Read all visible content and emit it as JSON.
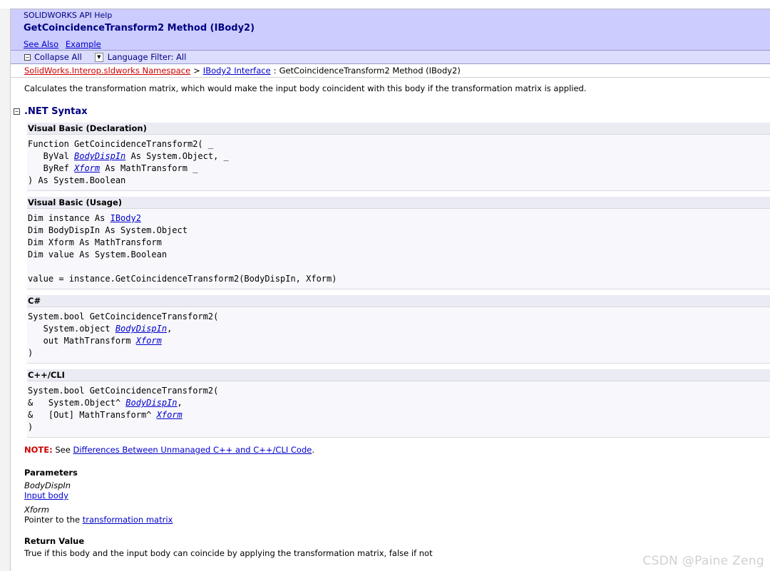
{
  "header": {
    "app_name": "SOLIDWORKS API Help",
    "title": "GetCoincidenceTransform2 Method (IBody2)",
    "links": [
      "See Also",
      "Example"
    ]
  },
  "toolbar": {
    "collapse_label": "Collapse All",
    "language_filter_label": "Language Filter: All"
  },
  "breadcrumb": {
    "namespace": "SolidWorks.Interop.sldworks Namespace",
    "sep1": ">",
    "interface": "IBody2 Interface",
    "sep2": ":",
    "current": "GetCoincidenceTransform2 Method (IBody2)"
  },
  "summary": "Calculates the transformation matrix, which would make the input body coincident with this body if the transformation matrix is applied.",
  "syntax_section": {
    "title": ".NET Syntax",
    "blocks": [
      {
        "header": "Visual Basic (Declaration)",
        "lines": [
          [
            {
              "t": "Function GetCoincidenceTransform2( _"
            }
          ],
          [
            {
              "t": "   ByVal "
            },
            {
              "t": "BodyDispIn",
              "link": true
            },
            {
              "t": " As System.Object, _"
            }
          ],
          [
            {
              "t": "   ByRef "
            },
            {
              "t": "Xform",
              "link": true
            },
            {
              "t": " As MathTransform _"
            }
          ],
          [
            {
              "t": ") As System.Boolean"
            }
          ]
        ]
      },
      {
        "header": "Visual Basic (Usage)",
        "lines": [
          [
            {
              "t": "Dim instance As "
            },
            {
              "t": "IBody2",
              "link": true,
              "plain": true
            }
          ],
          [
            {
              "t": "Dim BodyDispIn As System.Object"
            }
          ],
          [
            {
              "t": "Dim Xform As MathTransform"
            }
          ],
          [
            {
              "t": "Dim value As System.Boolean"
            }
          ],
          [
            {
              "t": " "
            }
          ],
          [
            {
              "t": "value = instance.GetCoincidenceTransform2(BodyDispIn, Xform)"
            }
          ]
        ]
      },
      {
        "header": "C#",
        "lines": [
          [
            {
              "t": "System.bool GetCoincidenceTransform2("
            }
          ],
          [
            {
              "t": "   System.object "
            },
            {
              "t": "BodyDispIn",
              "link": true
            },
            {
              "t": ","
            }
          ],
          [
            {
              "t": "   out MathTransform "
            },
            {
              "t": "Xform",
              "link": true
            }
          ],
          [
            {
              "t": ")"
            }
          ]
        ]
      },
      {
        "header": "C++/CLI",
        "lines": [
          [
            {
              "t": "System.bool GetCoincidenceTransform2("
            }
          ],
          [
            {
              "t": "&   System.Object^ "
            },
            {
              "t": "BodyDispIn",
              "link": true
            },
            {
              "t": ","
            }
          ],
          [
            {
              "t": "&   [Out] MathTransform^ "
            },
            {
              "t": "Xform",
              "link": true
            }
          ],
          [
            {
              "t": ")"
            }
          ]
        ]
      }
    ]
  },
  "note": {
    "label": "NOTE:",
    "prefix": " See ",
    "link": "Differences Between Unmanaged C++ and C++/CLI Code",
    "suffix": "."
  },
  "parameters": {
    "title": "Parameters",
    "items": [
      {
        "name": "BodyDispIn",
        "desc_prefix": "",
        "desc_link": "Input body"
      },
      {
        "name": "Xform",
        "desc_prefix": "Pointer to the ",
        "desc_link": "transformation matrix"
      }
    ]
  },
  "return_value": {
    "title": "Return Value",
    "text": "True if this body and the input body can coincide by applying the transformation matrix, false if not"
  },
  "watermark": "CSDN @Paine Zeng"
}
